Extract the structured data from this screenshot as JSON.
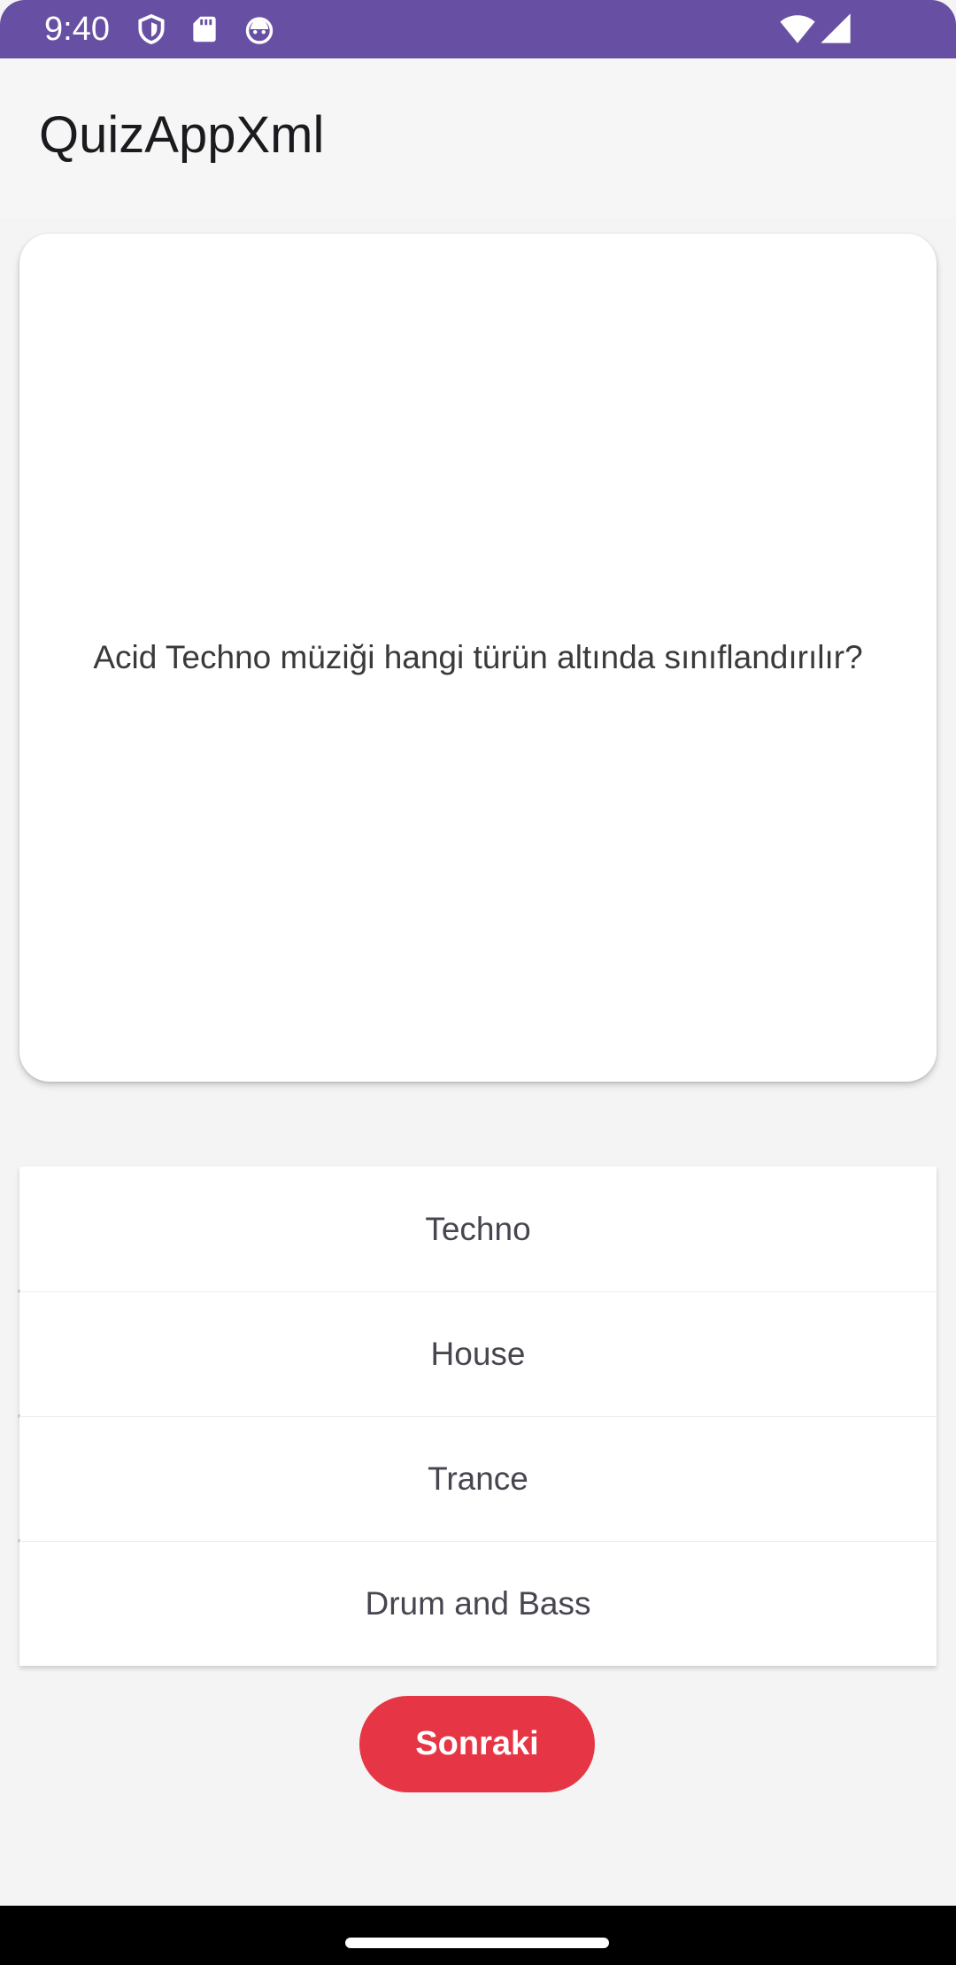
{
  "status_bar": {
    "time": "9:40",
    "background_color": "#6750a4",
    "left_icons": [
      "shield-icon",
      "sd-card-icon",
      "android-face-icon"
    ],
    "right_icons": [
      "wifi-icon",
      "cell-signal-icon"
    ]
  },
  "app_bar": {
    "title": "QuizAppXml"
  },
  "question": {
    "text": "Acid Techno müziği hangi türün altında sınıflandırılır?"
  },
  "options": [
    {
      "label": "Techno"
    },
    {
      "label": "House"
    },
    {
      "label": "Trance"
    },
    {
      "label": "Drum and Bass"
    }
  ],
  "next_button": {
    "label": "Sonraki",
    "color": "#e63645"
  }
}
